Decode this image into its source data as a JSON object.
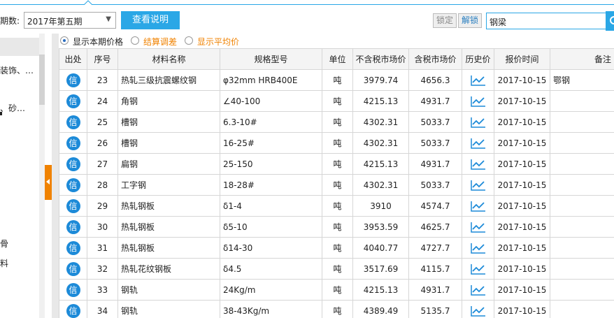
{
  "toolbar": {
    "period_label": "期数:",
    "period_value": "2017年第五期",
    "help_button": "查看说明",
    "lock_button": "锁定",
    "unlock_button": "解锁",
    "search_value": "钢梁"
  },
  "sidebar": {
    "items": [
      "装饰、…",
      "、砂…",
      "骨",
      "料"
    ]
  },
  "filters": {
    "options": [
      "显示本期价格",
      "结算调差",
      "显示平均价"
    ],
    "selected": "显示本期价格"
  },
  "table": {
    "headers": [
      "出处",
      "序号",
      "材料名称",
      "规格型号",
      "单位",
      "不含税市场价",
      "含税市场价",
      "历史价",
      "报价时间",
      "备注"
    ],
    "source_badge": "信",
    "rows": [
      {
        "no": "23",
        "name": "热轧三级抗震螺纹钢",
        "spec": "φ32mm HRB400E",
        "unit": "吨",
        "price_ex": "3979.74",
        "price_in": "4656.3",
        "date": "2017-10-15",
        "note": "鄂钢"
      },
      {
        "no": "24",
        "name": "角钢",
        "spec": "∠40-100",
        "unit": "吨",
        "price_ex": "4215.13",
        "price_in": "4931.7",
        "date": "2017-10-15",
        "note": ""
      },
      {
        "no": "25",
        "name": "槽钢",
        "spec": "6.3-10#",
        "unit": "吨",
        "price_ex": "4302.31",
        "price_in": "5033.7",
        "date": "2017-10-15",
        "note": ""
      },
      {
        "no": "26",
        "name": "槽钢",
        "spec": "16-25#",
        "unit": "吨",
        "price_ex": "4302.31",
        "price_in": "5033.7",
        "date": "2017-10-15",
        "note": ""
      },
      {
        "no": "27",
        "name": "扁钢",
        "spec": "25-150",
        "unit": "吨",
        "price_ex": "4215.13",
        "price_in": "4931.7",
        "date": "2017-10-15",
        "note": ""
      },
      {
        "no": "28",
        "name": "工字钢",
        "spec": "18-28#",
        "unit": "吨",
        "price_ex": "4302.31",
        "price_in": "5033.7",
        "date": "2017-10-15",
        "note": ""
      },
      {
        "no": "29",
        "name": "热轧钢板",
        "spec": "δ1-4",
        "unit": "吨",
        "price_ex": "3910",
        "price_in": "4574.7",
        "date": "2017-10-15",
        "note": ""
      },
      {
        "no": "30",
        "name": "热轧钢板",
        "spec": "δ5-10",
        "unit": "吨",
        "price_ex": "3953.59",
        "price_in": "4625.7",
        "date": "2017-10-15",
        "note": ""
      },
      {
        "no": "31",
        "name": "热轧钢板",
        "spec": "δ14-30",
        "unit": "吨",
        "price_ex": "4040.77",
        "price_in": "4727.7",
        "date": "2017-10-15",
        "note": ""
      },
      {
        "no": "32",
        "name": "热轧花纹钢板",
        "spec": "δ4.5",
        "unit": "吨",
        "price_ex": "3517.69",
        "price_in": "4115.7",
        "date": "2017-10-15",
        "note": ""
      },
      {
        "no": "33",
        "name": "钢轨",
        "spec": "24Kg/m",
        "unit": "吨",
        "price_ex": "4215.13",
        "price_in": "4931.7",
        "date": "2017-10-15",
        "note": ""
      },
      {
        "no": "34",
        "name": "钢轨",
        "spec": "38-43Kg/m",
        "unit": "吨",
        "price_ex": "4389.49",
        "price_in": "5135.7",
        "date": "2017-10-15",
        "note": ""
      }
    ]
  },
  "colors": {
    "accent": "#2aa7e6",
    "badge": "#1c8ad8",
    "orange_option": "#f08200",
    "trend_icon": "#1c8ad8"
  },
  "icons": {
    "trend": "line-chart-icon",
    "search": "search-icon",
    "collapse": "chevron-left-icon"
  }
}
